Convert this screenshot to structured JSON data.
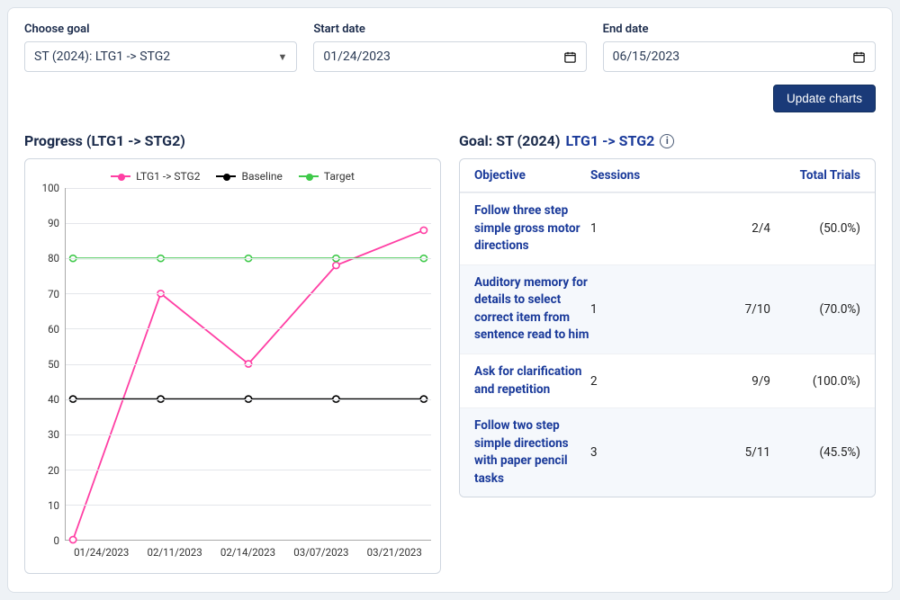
{
  "controls": {
    "goal_label": "Choose goal",
    "goal_value": "ST (2024): LTG1 -> STG2",
    "start_label": "Start date",
    "start_value": "01/24/2023",
    "end_label": "End date",
    "end_value": "06/15/2023",
    "update_button": "Update charts"
  },
  "progress": {
    "title": "Progress (LTG1 -> STG2)",
    "legend_series": "LTG1 -> STG2",
    "legend_baseline": "Baseline",
    "legend_target": "Target"
  },
  "chart_data": {
    "type": "line",
    "title": "Progress (LTG1 -> STG2)",
    "xlabel": "",
    "ylabel": "",
    "ylim": [
      0,
      100
    ],
    "yticks": [
      0,
      10,
      20,
      30,
      40,
      50,
      60,
      70,
      80,
      90,
      100
    ],
    "categories": [
      "01/24/2023",
      "02/11/2023",
      "02/14/2023",
      "03/07/2023",
      "03/21/2023"
    ],
    "series": [
      {
        "name": "LTG1 -> STG2",
        "color": "#ff3fa4",
        "values": [
          0,
          70,
          50,
          78,
          88
        ]
      },
      {
        "name": "Baseline",
        "color": "#000000",
        "values": [
          40,
          40,
          40,
          40,
          40
        ]
      },
      {
        "name": "Target",
        "color": "#3fc94a",
        "values": [
          80,
          80,
          80,
          80,
          80
        ]
      }
    ],
    "legend_position": "top",
    "grid": true
  },
  "goal_panel": {
    "prefix": "Goal: ST (2024)",
    "link": "LTG1 -> STG2",
    "headers": {
      "objective": "Objective",
      "sessions": "Sessions",
      "total_trials": "Total Trials"
    },
    "rows": [
      {
        "objective": "Follow three step simple gross motor directions",
        "sessions": "1",
        "trials": "2/4",
        "pct": "(50.0%)"
      },
      {
        "objective": "Auditory memory for details to select correct item from sentence read to him",
        "sessions": "1",
        "trials": "7/10",
        "pct": "(70.0%)"
      },
      {
        "objective": "Ask for clarification and repetition",
        "sessions": "2",
        "trials": "9/9",
        "pct": "(100.0%)"
      },
      {
        "objective": "Follow two step simple directions with paper pencil tasks",
        "sessions": "3",
        "trials": "5/11",
        "pct": "(45.5%)"
      }
    ]
  }
}
